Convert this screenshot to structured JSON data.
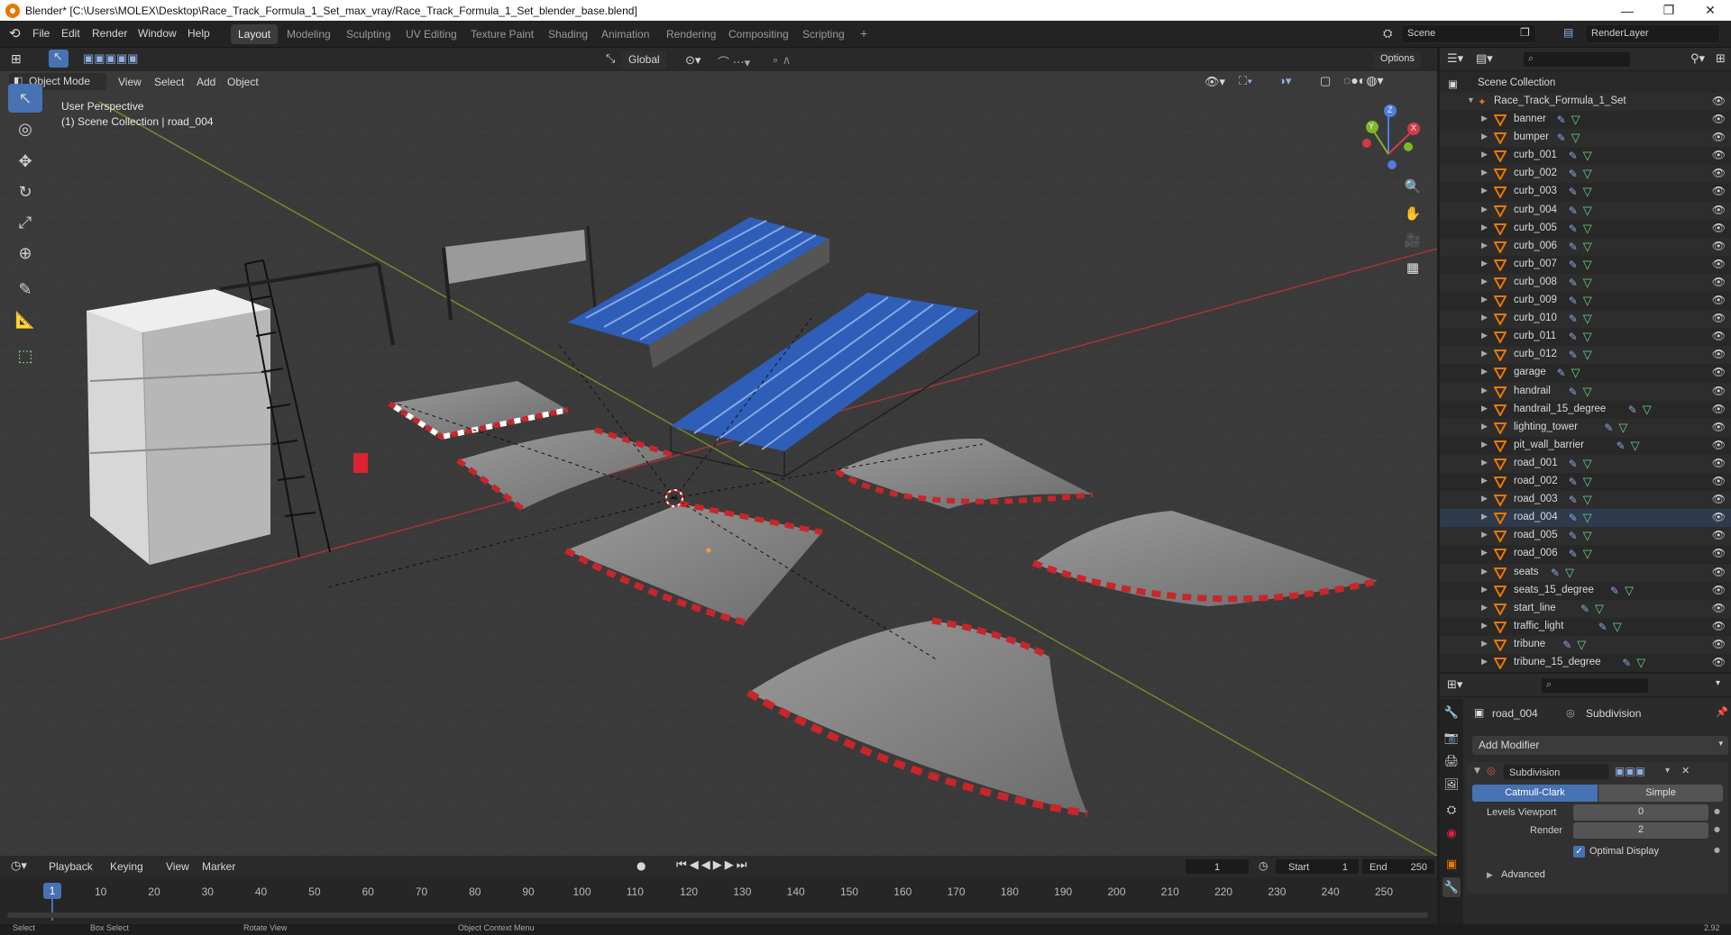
{
  "window": {
    "title": "Blender* [C:\\Users\\MOLEX\\Desktop\\Race_Track_Formula_1_Set_max_vray/Race_Track_Formula_1_Set_blender_base.blend]",
    "minimize": "—",
    "restore": "❐",
    "close": "✕"
  },
  "menu": [
    "File",
    "Edit",
    "Render",
    "Window",
    "Help"
  ],
  "workspaces": [
    {
      "label": "Layout",
      "active": true
    },
    {
      "label": "Modeling"
    },
    {
      "label": "Sculpting"
    },
    {
      "label": "UV Editing"
    },
    {
      "label": "Texture Paint"
    },
    {
      "label": "Shading"
    },
    {
      "label": "Animation"
    },
    {
      "label": "Rendering"
    },
    {
      "label": "Compositing"
    },
    {
      "label": "Scripting"
    }
  ],
  "add_workspace": "+",
  "scene": {
    "name": "Scene",
    "render_layer": "RenderLayer"
  },
  "toolbar_top": {
    "orientation": "Global",
    "options": "Options"
  },
  "viewport": {
    "mode": "Object Mode",
    "menus": [
      "View",
      "Select",
      "Add",
      "Object"
    ],
    "perspective": "User Perspective",
    "collection_info": "(1) Scene Collection | road_004",
    "gizmo": {
      "x": "X",
      "y": "Y",
      "z": "Z"
    }
  },
  "outliner": {
    "root": "Scene Collection",
    "collection": "Race_Track_Formula_1_Set",
    "objects": [
      "banner",
      "bumper",
      "curb_001",
      "curb_002",
      "curb_003",
      "curb_004",
      "curb_005",
      "curb_006",
      "curb_007",
      "curb_008",
      "curb_009",
      "curb_010",
      "curb_011",
      "curb_012",
      "garage",
      "handrail",
      "handrail_15_degree",
      "lighting_tower",
      "pit_wall_barrier",
      "road_001",
      "road_002",
      "road_003",
      "road_004",
      "road_005",
      "road_006",
      "seats",
      "seats_15_degree",
      "start_line",
      "traffic_light",
      "tribune",
      "tribune_15_degree"
    ],
    "selected": "road_004"
  },
  "properties": {
    "object": "road_004",
    "modifier_context": "Subdivision",
    "add_modifier": "Add Modifier",
    "modifier_name": "Subdivision",
    "methods": [
      "Catmull-Clark",
      "Simple"
    ],
    "active_method": "Catmull-Clark",
    "levels_viewport_label": "Levels Viewport",
    "levels_viewport": "0",
    "render_label": "Render",
    "render_levels": "2",
    "optimal_display": "Optimal Display",
    "advanced": "Advanced"
  },
  "timeline": {
    "menus": [
      "Playback",
      "Keying",
      "View",
      "Marker"
    ],
    "current_frame": "1",
    "start_label": "Start",
    "start": "1",
    "end_label": "End",
    "end": "250",
    "ticks": [
      "10",
      "20",
      "30",
      "40",
      "50",
      "60",
      "70",
      "80",
      "90",
      "100",
      "110",
      "120",
      "130",
      "140",
      "150",
      "160",
      "170",
      "180",
      "190",
      "200",
      "210",
      "220",
      "230",
      "240",
      "250"
    ]
  },
  "statusbar": {
    "select": "Select",
    "box_select": "Box Select",
    "rotate": "Rotate View",
    "context": "Object Context Menu",
    "version": "2.92"
  },
  "colors": {
    "accent": "#4772b3",
    "selected_row": "#334d80",
    "curb_red": "#c8262a",
    "seat_blue": "#3a6fd6"
  }
}
